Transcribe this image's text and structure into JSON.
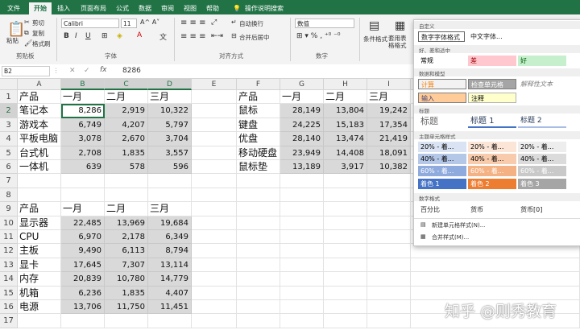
{
  "ribbon": {
    "tabs": [
      "文件",
      "开始",
      "插入",
      "页面布局",
      "公式",
      "数据",
      "审阅",
      "视图",
      "帮助"
    ],
    "tell_me": "操作说明搜索",
    "clipboard": {
      "cut": "剪切",
      "copy": "复制",
      "format_painter": "格式刷",
      "paste": "粘贴",
      "group": "剪贴板"
    },
    "font": {
      "name": "Calibri",
      "size": "11",
      "group": "字体"
    },
    "alignment": {
      "wrap": "自动换行",
      "merge": "合并后居中",
      "group": "对齐方式"
    },
    "number": {
      "format": "数值",
      "group": "数字"
    },
    "styles": {
      "conditional": "条件格式",
      "table": "套用表格格式"
    }
  },
  "formula_bar": {
    "name_box": "B2",
    "value": "8286"
  },
  "columns": [
    "A",
    "B",
    "C",
    "D",
    "E",
    "F",
    "G",
    "H",
    "I"
  ],
  "rows": [
    "1",
    "2",
    "3",
    "4",
    "5",
    "6",
    "7",
    "8",
    "9",
    "10",
    "11",
    "12",
    "13",
    "14",
    "15",
    "16",
    "17"
  ],
  "table1": {
    "headers": [
      "产品",
      "一月",
      "二月",
      "三月"
    ],
    "rows": [
      [
        "笔记本",
        "8,286",
        "2,919",
        "10,322"
      ],
      [
        "游戏本",
        "6,749",
        "4,207",
        "5,797"
      ],
      [
        "平板电脑",
        "3,078",
        "2,670",
        "3,704"
      ],
      [
        "台式机",
        "2,708",
        "1,835",
        "3,557"
      ],
      [
        "一体机",
        "639",
        "578",
        "596"
      ]
    ]
  },
  "table2": {
    "headers": [
      "产品",
      "一月",
      "二月",
      "三月"
    ],
    "rows": [
      [
        "鼠标",
        "28,149",
        "13,804",
        "19,242"
      ],
      [
        "键盘",
        "24,225",
        "15,183",
        "17,354"
      ],
      [
        "优盘",
        "28,140",
        "13,474",
        "21,419"
      ],
      [
        "移动硬盘",
        "23,949",
        "14,408",
        "18,091"
      ],
      [
        "鼠标垫",
        "13,189",
        "3,917",
        "10,382"
      ]
    ]
  },
  "table3": {
    "headers": [
      "产品",
      "一月",
      "二月",
      "三月"
    ],
    "rows": [
      [
        "显示器",
        "22,485",
        "13,969",
        "19,684"
      ],
      [
        "CPU",
        "6,970",
        "2,178",
        "6,349"
      ],
      [
        "主板",
        "9,490",
        "6,113",
        "8,794"
      ],
      [
        "显卡",
        "17,645",
        "7,307",
        "13,114"
      ],
      [
        "内存",
        "20,839",
        "10,780",
        "14,779"
      ],
      [
        "机箱",
        "6,236",
        "1,835",
        "4,407"
      ],
      [
        "电源",
        "13,706",
        "11,750",
        "11,451"
      ]
    ]
  },
  "style_panel": {
    "custom_header": "自定义",
    "custom_styles": [
      "数字字体格式",
      "中文字体..."
    ],
    "good_bad_header": "好、差和适中",
    "good_bad": [
      {
        "label": "常规",
        "bg": "#ffffff",
        "fg": "#000000"
      },
      {
        "label": "差",
        "bg": "#ffc7ce",
        "fg": "#9c0006"
      },
      {
        "label": "好",
        "bg": "#c6efce",
        "fg": "#006100"
      }
    ],
    "data_model_header": "数据和模型",
    "data_model": [
      {
        "label": "计算",
        "bg": "#f2f2f2",
        "fg": "#fa7d00"
      },
      {
        "label": "检查单元格",
        "bg": "#a5a5a5",
        "fg": "#ffffff"
      },
      {
        "label": "解释性文本",
        "bg": "#ffffff",
        "fg": "#7f7f7f"
      },
      {
        "label": "输入",
        "bg": "#ffcc99",
        "fg": "#3f3f76"
      },
      {
        "label": "注释",
        "bg": "#ffffcc",
        "fg": "#000000"
      }
    ],
    "titles_header": "标题",
    "titles": [
      "标题",
      "标题 1",
      "标题 2"
    ],
    "theme_header": "主题单元格样式",
    "theme_rows": [
      {
        "label": "20% - 着...",
        "colors": [
          "#dae3f3",
          "#fbe5d6",
          "#ededed"
        ]
      },
      {
        "label": "40% - 着...",
        "colors": [
          "#b4c7e7",
          "#f8cbad",
          "#dbdbdb"
        ]
      },
      {
        "label": "60% - 着...",
        "colors": [
          "#8faadc",
          "#f4b183",
          "#c9c9c9"
        ]
      }
    ],
    "accents": [
      {
        "label": "着色 1",
        "bg": "#4472c4"
      },
      {
        "label": "着色 2",
        "bg": "#ed7d31"
      },
      {
        "label": "着色 3",
        "bg": "#a5a5a5"
      }
    ],
    "number_header": "数字格式",
    "number_formats": [
      "百分比",
      "货币",
      "货币[0]"
    ],
    "new_style": "新建单元格样式(N)...",
    "merge_styles": "合并样式(M)..."
  },
  "watermark": "知乎 @则秀教育"
}
